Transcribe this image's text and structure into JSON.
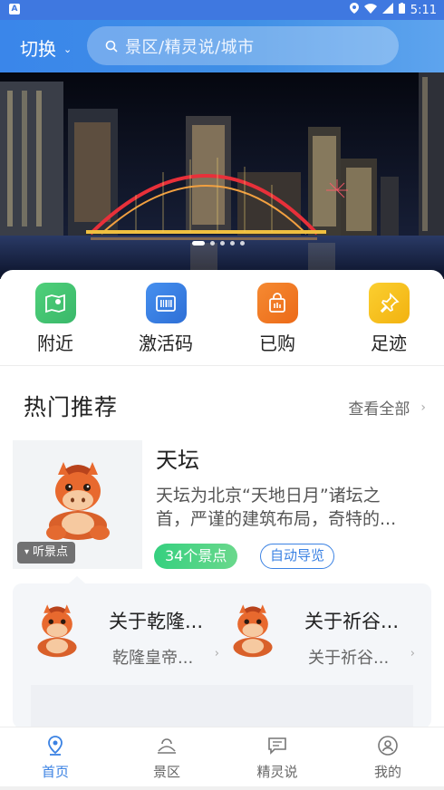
{
  "status_bar": {
    "time": "5:11"
  },
  "header": {
    "switch_label": "切换",
    "search_placeholder": "景区/精灵说/城市"
  },
  "banner": {
    "slides": 5,
    "active_index": 0
  },
  "quick_entries": [
    {
      "label": "附近",
      "icon": "map-pin-icon",
      "color": "#44c76e"
    },
    {
      "label": "激活码",
      "icon": "barcode-icon",
      "color": "#3b82e3"
    },
    {
      "label": "已购",
      "icon": "shopping-bag-icon",
      "color": "#f07a22"
    },
    {
      "label": "足迹",
      "icon": "pushpin-icon",
      "color": "#f7c120"
    }
  ],
  "hot": {
    "title": "热门推荐",
    "more": "查看全部",
    "feature": {
      "title": "天坛",
      "desc_line1": "天坛为北京“天地日月”诸坛之",
      "desc_line2": "首，严谨的建筑布局，奇特的...",
      "listen_label": "听景点",
      "spots_tag": "34个景点",
      "guide_tag": "自动导览"
    },
    "subs": [
      {
        "title": "关于乾隆...",
        "desc": "乾隆皇帝..."
      },
      {
        "title": "关于祈谷...",
        "desc": "关于祈谷..."
      }
    ]
  },
  "bottom_nav": [
    {
      "label": "首页",
      "icon": "home-location-icon",
      "active": true
    },
    {
      "label": "景区",
      "icon": "scenic-icon",
      "active": false
    },
    {
      "label": "精灵说",
      "icon": "message-icon",
      "active": false
    },
    {
      "label": "我的",
      "icon": "user-icon",
      "active": false
    }
  ],
  "colors": {
    "primary": "#3b82e3",
    "green": "#44c76e",
    "orange": "#f07a22",
    "yellow": "#f7c120"
  }
}
